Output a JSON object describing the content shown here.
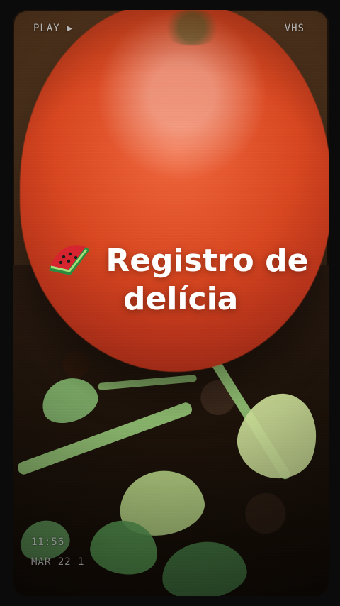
{
  "overlay": {
    "play": "PLAY ▶",
    "mode": "VHS",
    "time": "11:56",
    "date": "MAR 22 1"
  },
  "caption": {
    "line1": "Registro de",
    "line2": "delícia"
  },
  "icons": {
    "emoji": "watermelon-icon"
  }
}
